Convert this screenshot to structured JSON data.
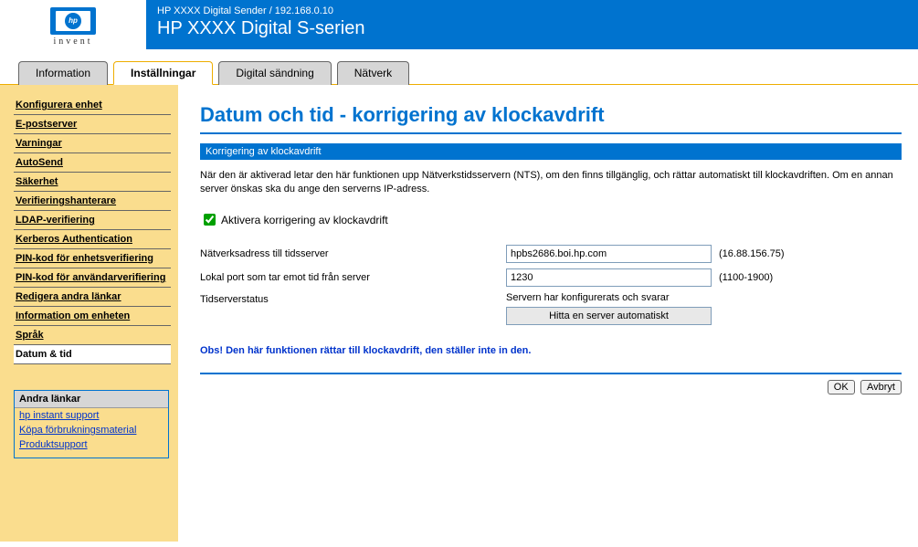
{
  "header": {
    "breadcrumb": "HP XXXX Digital Sender / 192.168.0.10",
    "title": "HP XXXX Digital S-serien",
    "invent": "invent"
  },
  "tabs": {
    "information": "Information",
    "settings": "Inställningar",
    "digital_sending": "Digital sändning",
    "network": "Nätverk"
  },
  "sidebar": {
    "items": [
      "Konfigurera enhet",
      "E-postserver",
      "Varningar",
      "AutoSend",
      "Säkerhet",
      "Verifieringshanterare",
      "LDAP-verifiering",
      "Kerberos Authentication",
      "PIN-kod för enhetsverifiering",
      "PIN-kod för användarverifiering",
      "Redigera andra länkar",
      "Information om enheten",
      "Språk",
      "Datum & tid"
    ],
    "selected_index": 13
  },
  "other_links": {
    "title": "Andra länkar",
    "links": [
      "hp instant support",
      "Köpa förbrukningsmaterial",
      "Produktsupport"
    ]
  },
  "main": {
    "page_title": "Datum och tid - korrigering av klockavdrift",
    "section_header": "Korrigering av klockavdrift",
    "intro_text": "När den är aktiverad letar den här funktionen upp Nätverkstidsservern (NTS), om den finns tillgänglig, och rättar automatiskt till klockavdriften. Om en annan server önskas ska du ange den serverns IP-adress.",
    "checkbox_label": "Aktivera korrigering av klockavdrift",
    "checkbox_checked": true,
    "field_address_label": "Nätverksadress till tidsserver",
    "field_address_value": "hpbs2686.boi.hp.com",
    "field_address_note": "(16.88.156.75)",
    "field_port_label": "Lokal port som tar emot tid från server",
    "field_port_value": "1230",
    "field_port_note": "(1100-1900)",
    "field_status_label": "Tidserverstatus",
    "field_status_text": "Servern har konfigurerats och svarar",
    "auto_button": "Hitta en server automatiskt",
    "highlight": "Obs! Den här funktionen rättar till klockavdrift, den ställer inte in den.",
    "ok": "OK",
    "cancel": "Avbryt"
  }
}
